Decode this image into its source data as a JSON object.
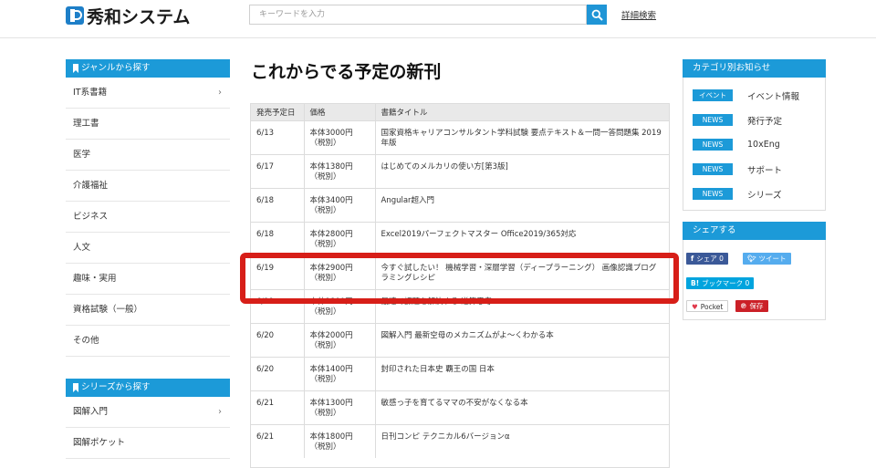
{
  "header": {
    "logo_text": "秀和システム",
    "search_placeholder": "キーワードを入力",
    "advanced_search": "詳細検索"
  },
  "left_sidebar": {
    "genre_title": "ジャンルから探す",
    "genres": [
      "IT系書籍",
      "理工書",
      "医学",
      "介護福祉",
      "ビジネス",
      "人文",
      "趣味・実用",
      "資格試験（一般）",
      "その他"
    ],
    "series_title": "シリーズから探す",
    "series": [
      "図解入門",
      "図解ポケット"
    ]
  },
  "main": {
    "title": "これからでる予定の新刊",
    "columns": [
      "発売予定日",
      "価格",
      "書籍タイトル"
    ],
    "rows": [
      {
        "date": "6/13",
        "price": "本体3000円",
        "tax": "（税別）",
        "title": "国家資格キャリアコンサルタント学科試験 要点テキスト＆一問一答問題集 2019年版"
      },
      {
        "date": "6/17",
        "price": "本体1380円",
        "tax": "（税別）",
        "title": "はじめてのメルカリの使い方[第3版]"
      },
      {
        "date": "6/18",
        "price": "本体3400円",
        "tax": "（税別）",
        "title": "Angular超入門"
      },
      {
        "date": "6/18",
        "price": "本体2800円",
        "tax": "（税別）",
        "title": "Excel2019パーフェクトマスター Office2019/365対応"
      },
      {
        "date": "6/19",
        "price": "本体2900円",
        "tax": "（税別）",
        "title": "今すぐ試したい！ 機械学習・深層学習（ディープラーニング） 画像認識プログラミングレシピ"
      },
      {
        "date": "6/19",
        "price": "本体1800円",
        "tax": "（税別）",
        "title": "最速で課題を解決する 逆算思考"
      },
      {
        "date": "6/20",
        "price": "本体2000円",
        "tax": "（税別）",
        "title": "図解入門 最新空母のメカニズムがよ～くわかる本"
      },
      {
        "date": "6/20",
        "price": "本体1400円",
        "tax": "（税別）",
        "title": "封印された日本史 覇王の国 日本"
      },
      {
        "date": "6/21",
        "price": "本体1300円",
        "tax": "（税別）",
        "title": "敏感っ子を育てるママの不安がなくなる本"
      },
      {
        "date": "6/21",
        "price": "本体1800円",
        "tax": "（税別）",
        "title": "日刊コンピ テクニカル6バージョンα"
      }
    ]
  },
  "right_sidebar": {
    "news_title": "カテゴリ別お知らせ",
    "news": [
      {
        "tag": "イベント",
        "label": "イベント情報"
      },
      {
        "tag": "NEWS",
        "label": "発行予定"
      },
      {
        "tag": "NEWS",
        "label": "10xEng"
      },
      {
        "tag": "NEWS",
        "label": "サポート"
      },
      {
        "tag": "NEWS",
        "label": "シリーズ"
      }
    ],
    "share_title": "シェアする",
    "share": {
      "facebook": "シェア 0",
      "twitter": "ツイート",
      "hatena": "ブックマーク 0",
      "hatena_glyph": "B!",
      "pocket": "Pocket",
      "save": "保存"
    }
  },
  "colors": {
    "accent": "#1c9ad8",
    "highlight": "#d71e18"
  }
}
